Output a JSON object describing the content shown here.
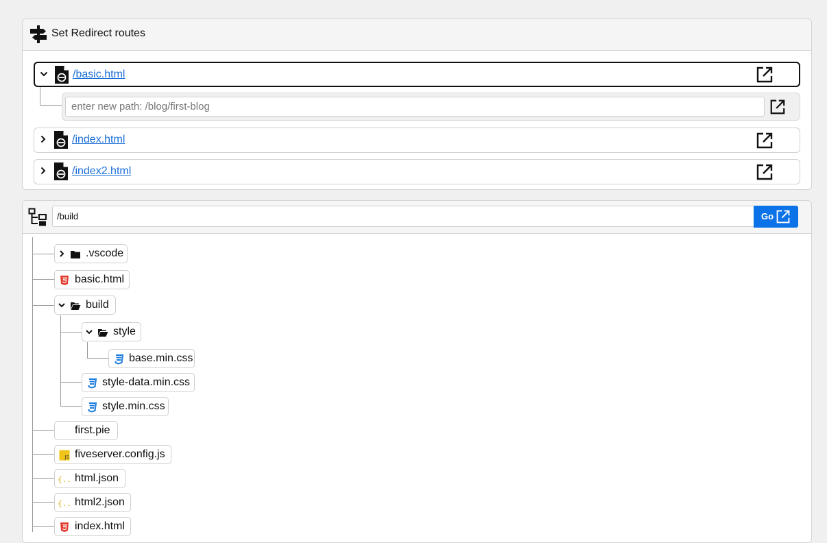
{
  "redirect": {
    "title": "Set Redirect routes",
    "routes": [
      {
        "path": "/basic.html",
        "expanded": true
      },
      {
        "path": "/index.html",
        "expanded": false
      },
      {
        "path": "/index2.html",
        "expanded": false
      }
    ],
    "new_path_placeholder": "enter new path: /blog/first-blog"
  },
  "explorer": {
    "path_value": "/build",
    "go_label": "Go",
    "nodes": [
      {
        "label": ".vscode",
        "icon": "folder-icon"
      },
      {
        "label": "basic.html",
        "icon": "html5-icon"
      },
      {
        "label": "build",
        "icon": "folder-open-icon"
      },
      {
        "label": "style",
        "icon": "folder-open-icon"
      },
      {
        "label": "base.min.css",
        "icon": "css3-icon"
      },
      {
        "label": "style-data.min.css",
        "icon": "css3-icon"
      },
      {
        "label": "style.min.css",
        "icon": "css3-icon"
      },
      {
        "label": "first.pie",
        "icon": "none"
      },
      {
        "label": "fiveserver.config.js",
        "icon": "js-icon"
      },
      {
        "label": "html.json",
        "icon": "json-icon"
      },
      {
        "label": "html2.json",
        "icon": "json-icon"
      },
      {
        "label": "index.html",
        "icon": "html5-icon"
      }
    ]
  },
  "colors": {
    "link": "#1a6ed8",
    "go_button": "#0b72e7",
    "html_icon": "#e43a2c",
    "css_icon": "#1a7be0",
    "js_icon": "#f0c419",
    "json_icon": "#d9a400"
  }
}
